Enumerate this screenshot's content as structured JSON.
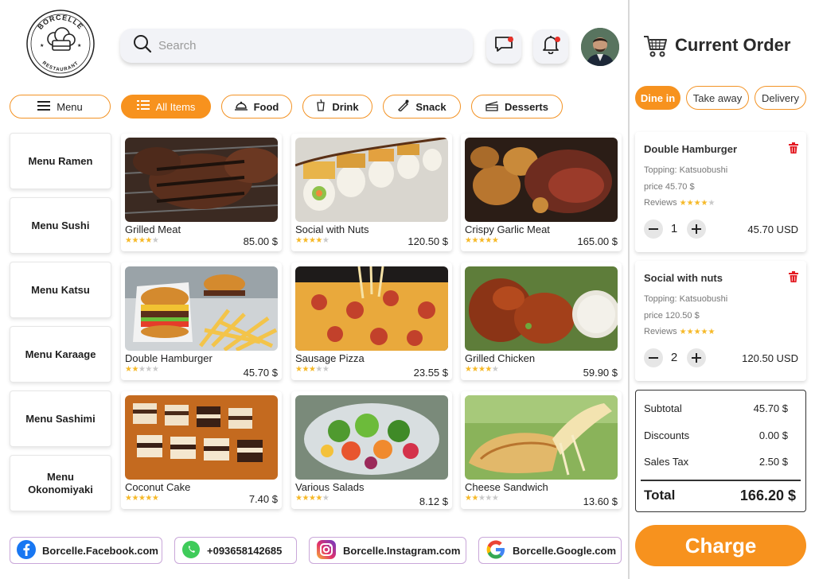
{
  "brand": {
    "name_top": "BORCELLE",
    "name_bottom": "RESTAURANT"
  },
  "header": {
    "search_placeholder": "Search",
    "icons": [
      "search-icon",
      "chat-icon",
      "bell-icon"
    ],
    "has_message_notification": true,
    "has_bell_notification": true
  },
  "categories": [
    {
      "label": "Menu",
      "icon": "hamburger-menu-icon",
      "active": false
    },
    {
      "label": "All Items",
      "icon": "list-icon",
      "active": true
    },
    {
      "label": "Food",
      "icon": "food-cover-icon",
      "active": false
    },
    {
      "label": "Drink",
      "icon": "cup-icon",
      "active": false
    },
    {
      "label": "Snack",
      "icon": "snack-icon",
      "active": false
    },
    {
      "label": "Desserts",
      "icon": "cake-icon",
      "active": false
    }
  ],
  "menus": [
    "Menu Ramen",
    "Menu Sushi",
    "Menu Katsu",
    "Menu Karaage",
    "Menu Sashimi",
    "Menu Okonomiyaki"
  ],
  "foods": [
    {
      "name": "Grilled Meat",
      "price": "85.00 $",
      "rating": 4
    },
    {
      "name": "Social with Nuts",
      "price": "120.50 $",
      "rating": 4
    },
    {
      "name": "Crispy Garlic Meat",
      "price": "165.00 $",
      "rating": 5
    },
    {
      "name": "Double Hamburger",
      "price": "45.70 $",
      "rating": 2
    },
    {
      "name": "Sausage Pizza",
      "price": "23.55 $",
      "rating": 3
    },
    {
      "name": "Grilled Chicken",
      "price": "59.90 $",
      "rating": 4
    },
    {
      "name": "Coconut Cake",
      "price": "7.40 $",
      "rating": 5
    },
    {
      "name": "Various Salads",
      "price": "8.12 $",
      "rating": 4
    },
    {
      "name": "Cheese Sandwich",
      "price": "13.60 $",
      "rating": 2
    }
  ],
  "social": [
    {
      "label": "Borcelle.Facebook.com",
      "icon": "facebook-icon"
    },
    {
      "label": "+093658142685",
      "icon": "whatsapp-icon"
    },
    {
      "label": "Borcelle.Instagram.com",
      "icon": "instagram-icon"
    },
    {
      "label": "Borcelle.Google.com",
      "icon": "google-icon"
    }
  ],
  "order": {
    "title": "Current Order",
    "types": [
      {
        "label": "Dine in",
        "active": true
      },
      {
        "label": "Take away",
        "active": false
      },
      {
        "label": "Delivery",
        "active": false
      }
    ],
    "items": [
      {
        "name": "Double Hamburger",
        "topping": "Topping: Katsuobushi",
        "price": "price 45.70 $",
        "reviews_label": "Reviews",
        "rating": 4,
        "qty": "1",
        "total": "45.70 USD"
      },
      {
        "name": "Social with nuts",
        "topping": "Topping: Katsuobushi",
        "price": "price 120.50 $",
        "reviews_label": "Reviews",
        "rating": 5,
        "qty": "2",
        "total": "120.50 USD"
      }
    ],
    "summary": {
      "subtotal_label": "Subtotal",
      "subtotal": "45.70 $",
      "discounts_label": "Discounts",
      "discounts": "0.00 $",
      "tax_label": "Sales Tax",
      "tax": "2.50 $",
      "total_label": "Total",
      "total": "166.20 $"
    },
    "charge_label": "Charge"
  },
  "colors": {
    "accent": "#f7921e",
    "star": "#f6b928",
    "trash": "#e31b23",
    "notification": "#e8312a"
  }
}
